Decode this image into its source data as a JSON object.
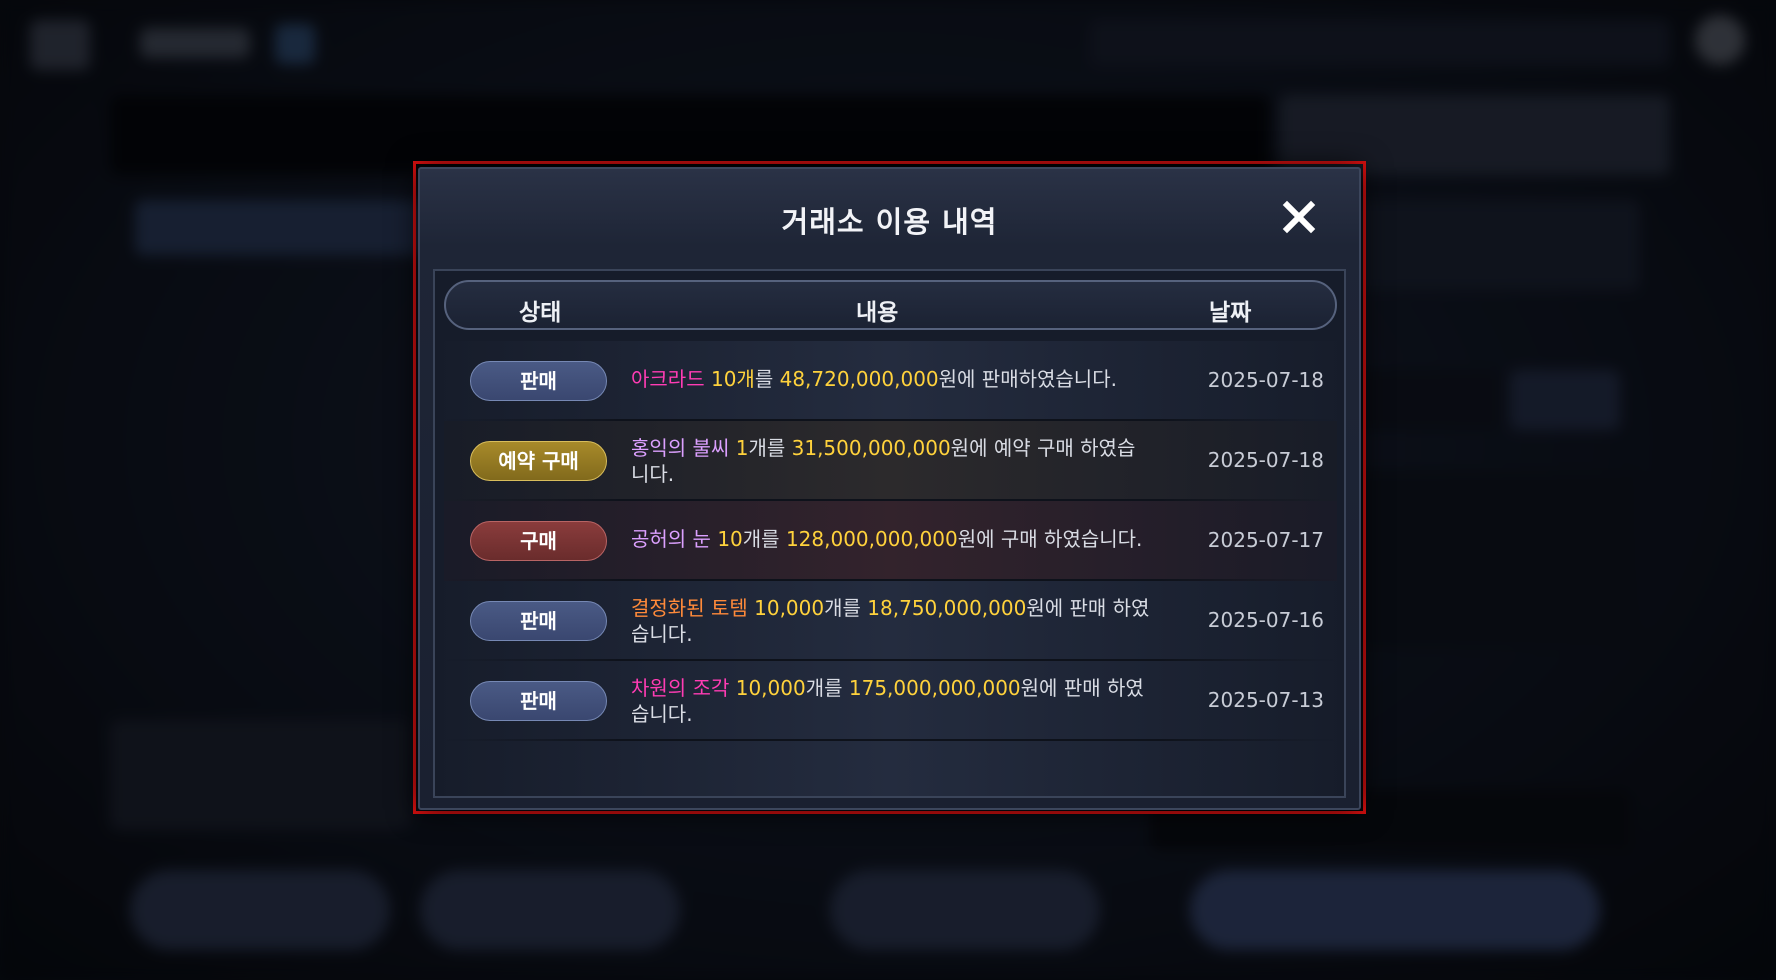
{
  "modal": {
    "title": "거래소 이용 내역",
    "headers": {
      "status": "상태",
      "content": "내용",
      "date": "날짜"
    }
  },
  "rows": [
    {
      "status": "판매",
      "item": "아크라드",
      "qty": "10개",
      "qty_suffix": "를 ",
      "price": "48,720,000,000",
      "tail": "원에 판매하였습니다.",
      "date": "2025-07-18"
    },
    {
      "status": "예약 구매",
      "item": "홍익의 불씨",
      "qty": "1",
      "qty_suffix": "개를 ",
      "price": "31,500,000,000",
      "tail": "원에 예약 구매 하였습니다.",
      "date": "2025-07-18"
    },
    {
      "status": "구매",
      "item": "공허의 눈",
      "qty": "10",
      "qty_suffix": "개를 ",
      "price": "128,000,000,000",
      "tail": "원에 구매 하였습니다.",
      "date": "2025-07-17"
    },
    {
      "status": "판매",
      "item": "결정화된 토템",
      "qty": "10,000",
      "qty_suffix": "개를 ",
      "price": "18,750,000,000",
      "tail": "원에 판매 하였습니다.",
      "date": "2025-07-16"
    },
    {
      "status": "판매",
      "item": "차원의 조각",
      "qty": "10,000",
      "qty_suffix": "개를 ",
      "price": "175,000,000,000",
      "tail": "원에 판매 하였습니다.",
      "date": "2025-07-13"
    }
  ],
  "colors": {
    "highlight_frame": "#e01010",
    "badge_sell": "#3a4770",
    "badge_reserve": "#a88a2a",
    "badge_buy": "#8a3c3c",
    "price": "#ffd23c",
    "item_pink": "#ff3cb4",
    "item_violet": "#dca0ff",
    "item_orange": "#ff8a3a"
  },
  "icons": {
    "close": "close-icon"
  }
}
